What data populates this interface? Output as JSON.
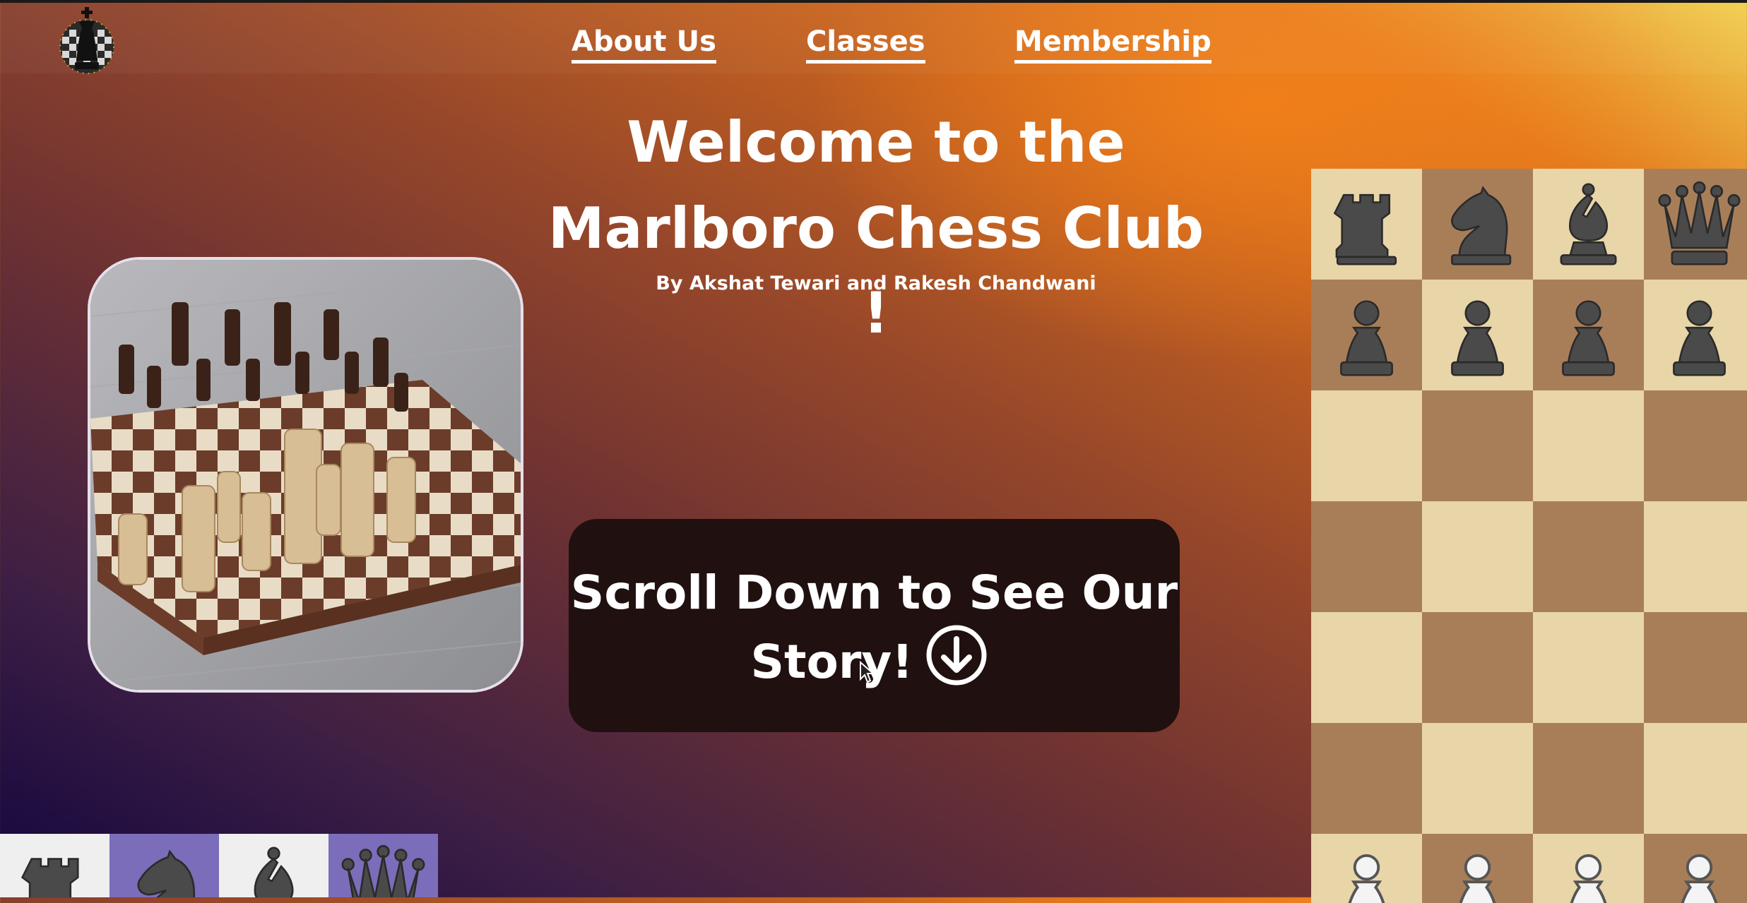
{
  "nav": {
    "logo_icon": "chess-king-logo-icon",
    "links": [
      "About Us",
      "Classes",
      "Membership"
    ]
  },
  "hero": {
    "title_line1": "Welcome to the",
    "title_line2": "Marlboro Chess Club !",
    "subtitle": "By Akshat Tewari and Rakesh Chandwani"
  },
  "photo": {
    "alt": "Chess pieces on a wooden board"
  },
  "cta": {
    "line1": "Scroll Down to See Our",
    "line2": "Story!",
    "icon": "arrow-down-circle-icon"
  },
  "board": {
    "back_rank": [
      "rook",
      "knight",
      "bishop",
      "queen"
    ],
    "pawns": "pawn",
    "colors": {
      "light": "#e8d5a8",
      "dark": "#a87e59"
    }
  },
  "strip": {
    "pieces": [
      "rook",
      "knight",
      "bishop",
      "queen"
    ],
    "colors": {
      "light": "#efefef",
      "purple": "#7c6dba"
    }
  }
}
